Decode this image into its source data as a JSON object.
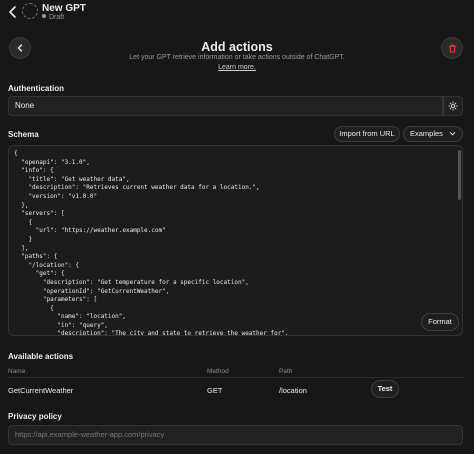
{
  "gpt": {
    "name": "New GPT",
    "status": "Draft"
  },
  "page": {
    "title": "Add actions",
    "subtitle": "Let your GPT retrieve information or take actions outside of ChatGPT.",
    "learn_more": "Learn more."
  },
  "authentication": {
    "label": "Authentication",
    "value": "None"
  },
  "schema": {
    "label": "Schema",
    "import_label": "Import from URL",
    "examples_label": "Examples",
    "format_label": "Format",
    "code": "{\n  \"openapi\": \"3.1.0\",\n  \"info\": {\n    \"title\": \"Get weather data\",\n    \"description\": \"Retrieves current weather data for a location.\",\n    \"version\": \"v1.0.0\"\n  },\n  \"servers\": [\n    {\n      \"url\": \"https://weather.example.com\"\n    }\n  ],\n  \"paths\": {\n    \"/location\": {\n      \"get\": {\n        \"description\": \"Get temperature for a specific location\",\n        \"operationId\": \"GetCurrentWeather\",\n        \"parameters\": [\n          {\n            \"name\": \"location\",\n            \"in\": \"query\",\n            \"description\": \"The city and state to retrieve the weather for\",\n            \"required\": true,\n            \"schema\": {"
  },
  "available_actions": {
    "label": "Available actions",
    "columns": {
      "name": "Name",
      "method": "Method",
      "path": "Path"
    },
    "rows": [
      {
        "name": "GetCurrentWeather",
        "method": "GET",
        "path": "/location",
        "test_label": "Test"
      }
    ]
  },
  "privacy": {
    "label": "Privacy policy",
    "placeholder": "https://api.example-weather-app.com/privacy"
  },
  "colors": {
    "background": "#171717",
    "surface": "#212121",
    "danger": "#e0443e"
  },
  "icons": [
    "chevron-left-icon",
    "trash-icon",
    "gear-icon",
    "chevron-down-icon"
  ]
}
